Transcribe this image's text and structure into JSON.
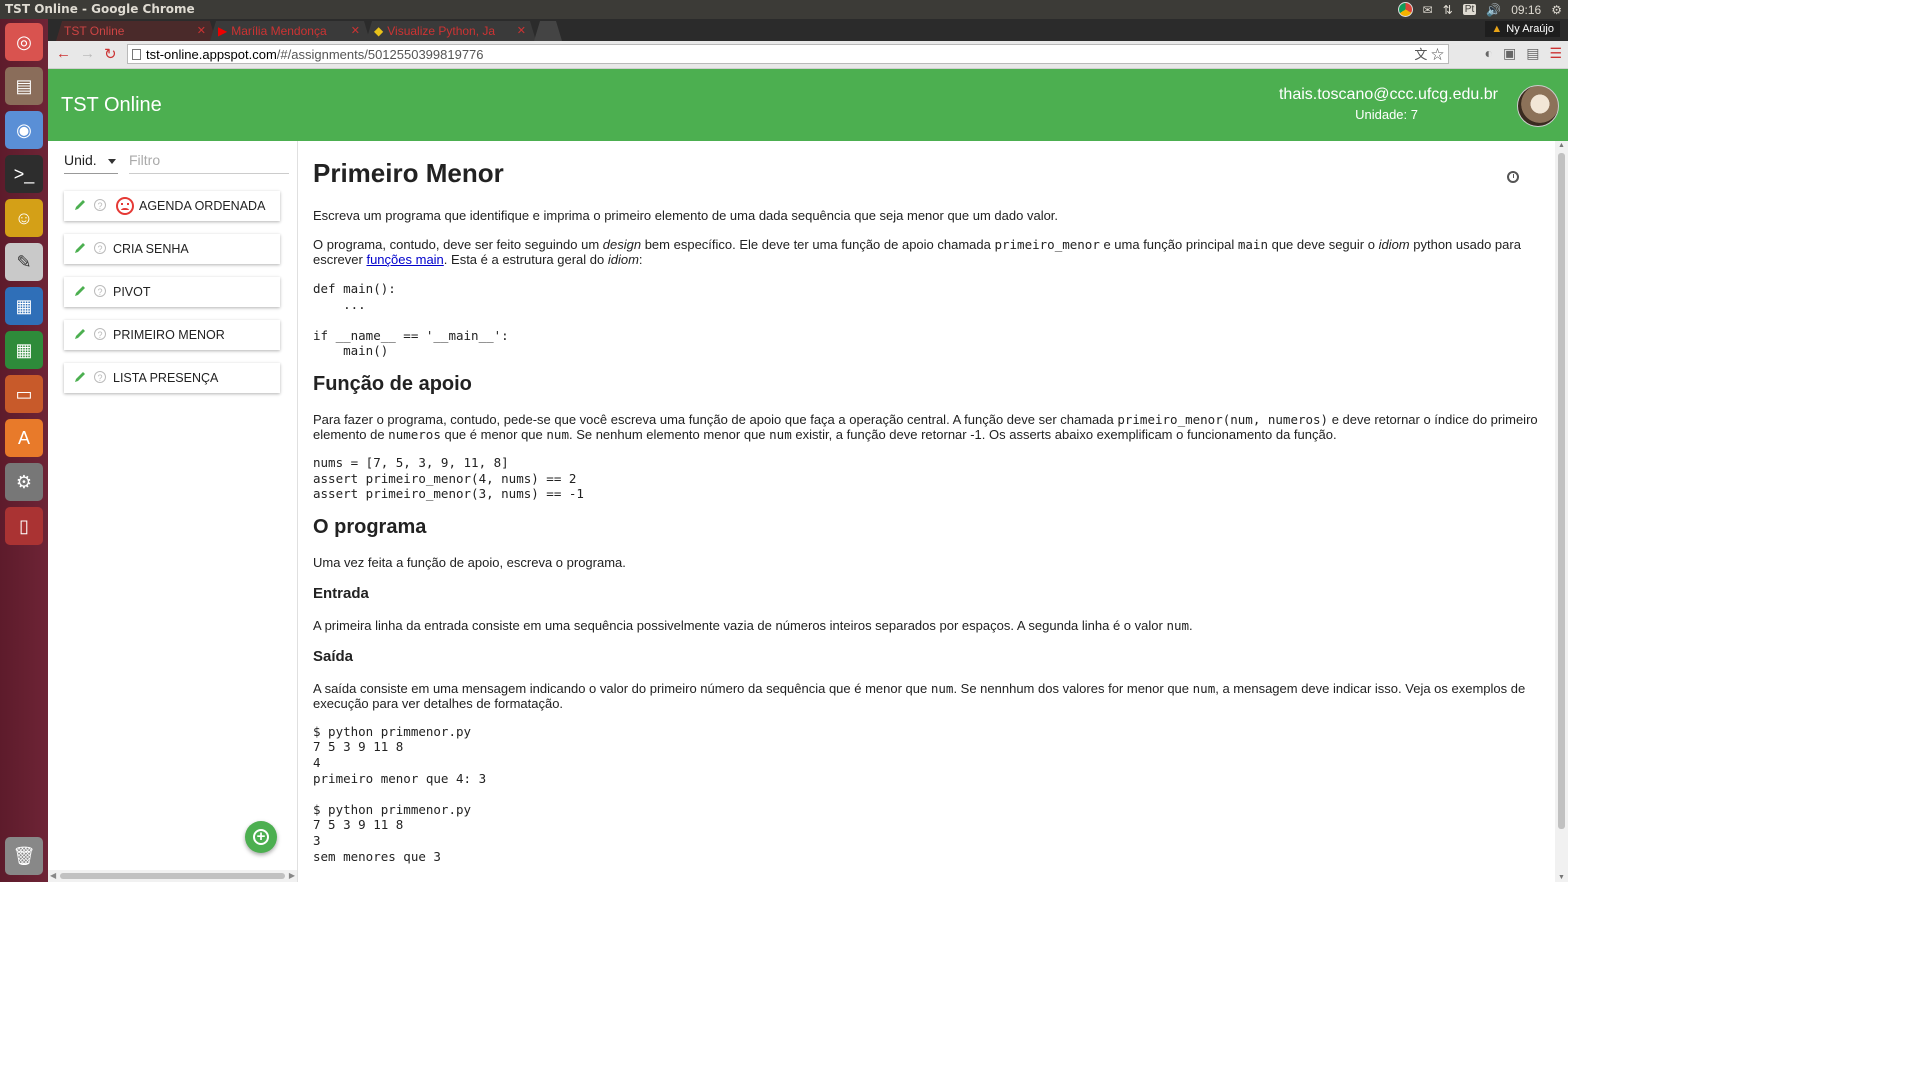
{
  "window": {
    "title": "TST Online - Google Chrome"
  },
  "tray": {
    "time": "09:16",
    "language": "Pt"
  },
  "browser": {
    "tabs": [
      {
        "label": "TST Online"
      },
      {
        "label": "Marília Mendonça"
      },
      {
        "label": "Visualize Python, Ja"
      }
    ],
    "user": "Ny Araújo",
    "url_host": "tst-online.appspot.com",
    "url_path": "/#/assignments/5012550399819776"
  },
  "header": {
    "brand": "TST Online",
    "email": "thais.toscano@ccc.ufcg.edu.br",
    "unit": "Unidade: 7"
  },
  "sidebar": {
    "unit_label": "Unid.",
    "filter_placeholder": "Filtro",
    "items": [
      {
        "label": "AGENDA ORDENADA"
      },
      {
        "label": "CRIA SENHA"
      },
      {
        "label": "PIVOT"
      },
      {
        "label": "PRIMEIRO MENOR"
      },
      {
        "label": "LISTA PRESENÇA"
      }
    ]
  },
  "assignment": {
    "title": "Primeiro Menor",
    "intro": "Escreva um programa que identifique e imprima o primeiro elemento de uma dada sequência que seja menor que um dado valor.",
    "p2": {
      "a": "O programa, contudo, deve ser feito seguindo um ",
      "b": "design",
      "c": " bem específico. Ele deve ter uma função de apoio chamada ",
      "d": "primeiro_menor",
      "e": " e uma função principal ",
      "f": "main",
      "g": " que deve seguir o ",
      "h": "idiom",
      "i": " python usado para escrever ",
      "link": "funções main",
      "j": ". Esta é a estrutura geral do ",
      "k": "idiom",
      "l": ":"
    },
    "code1": "def main():\n    ...\n\nif __name__ == '__main__':\n    main()",
    "h_apoio": "Função de apoio",
    "p3": {
      "a": "Para fazer o programa, contudo, pede-se que você escreva uma função de apoio que faça a operação central. A função deve ser chamada ",
      "b": "primeiro_menor(num, numeros)",
      "c": " e deve retornar o índice do primeiro elemento de ",
      "d": "numeros",
      "e": " que é menor que ",
      "f": "num",
      "g": ". Se nenhum elemento menor que ",
      "h": "num",
      "i": " existir, a função deve retornar -1. Os asserts abaixo exemplificam o funcionamento da função."
    },
    "code2": "nums = [7, 5, 3, 9, 11, 8]\nassert primeiro_menor(4, nums) == 2\nassert primeiro_menor(3, nums) == -1",
    "h_programa": "O programa",
    "p4": "Uma vez feita a função de apoio, escreva o programa.",
    "h_entrada": "Entrada",
    "p5": {
      "a": "A primeira linha da entrada consiste em uma sequência possivelmente vazia de números inteiros separados por espaços. A segunda linha é o valor ",
      "b": "num",
      "c": "."
    },
    "h_saida": "Saída",
    "p6": {
      "a": "A saída consiste em uma mensagem indicando o valor do primeiro número da sequência que é menor que ",
      "b": "num",
      "c": ". Se nennhum dos valores for menor que ",
      "d": "num",
      "e": ", a mensagem deve indicar isso. Veja os exemplos de execução para ver detalhes de formatação."
    },
    "code3": "$ python primmenor.py\n7 5 3 9 11 8\n4\nprimeiro menor que 4: 3\n\n$ python primmenor.py\n7 5 3 9 11 8\n3\nsem menores que 3"
  },
  "colors": {
    "header": "#4caf50",
    "link": "#0000cc",
    "sad": "#e53935"
  }
}
